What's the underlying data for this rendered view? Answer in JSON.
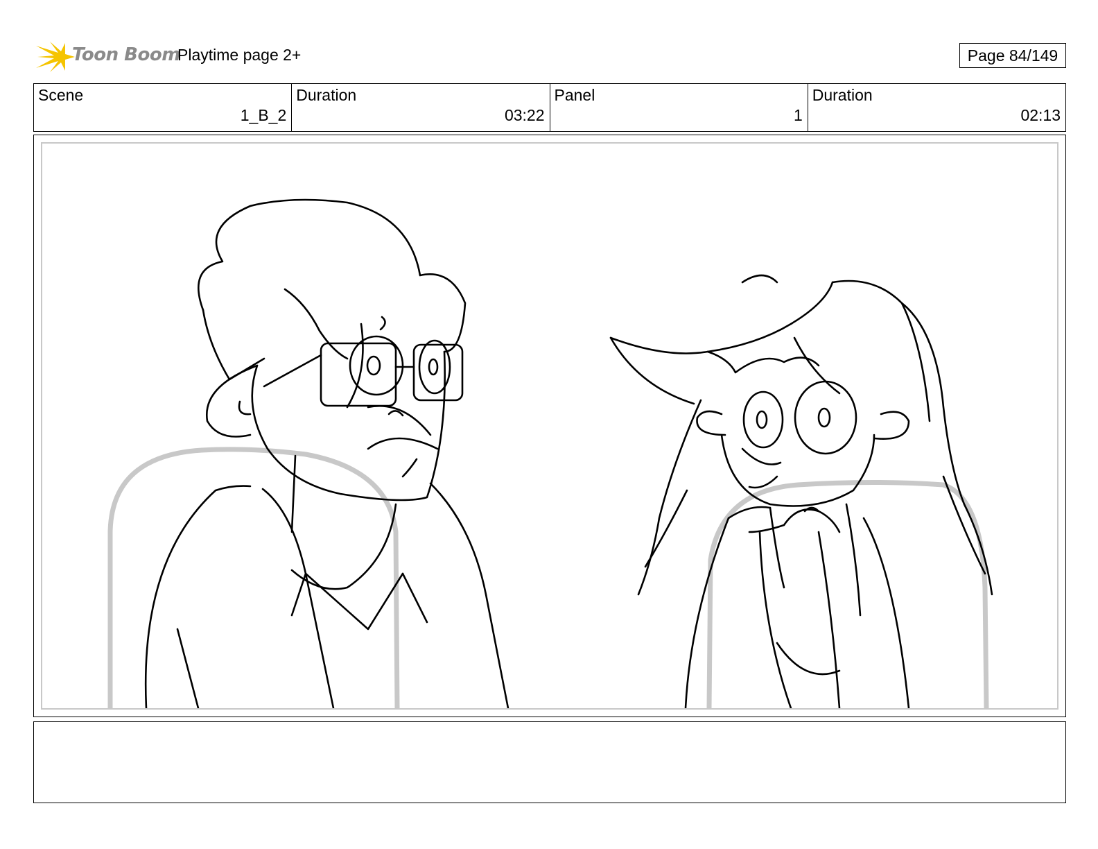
{
  "header": {
    "brand_logo_text": "Toon Boom",
    "project_title": "Playtime page 2+",
    "page_label": "Page",
    "page_number": "84/149"
  },
  "info_fields": [
    {
      "label": "Scene",
      "value": "1_B_2"
    },
    {
      "label": "Duration",
      "value": "03:22"
    },
    {
      "label": "Panel",
      "value": "1"
    },
    {
      "label": "Duration",
      "value": "02:13"
    }
  ],
  "panel": {
    "illustration": "sketch-two-characters"
  },
  "notes": {
    "text": ""
  },
  "colors": {
    "logo_star": "#f5c400",
    "logo_text": "#8a8a8a",
    "sketch_line": "#000000",
    "chair_line": "#c8c8c8"
  }
}
